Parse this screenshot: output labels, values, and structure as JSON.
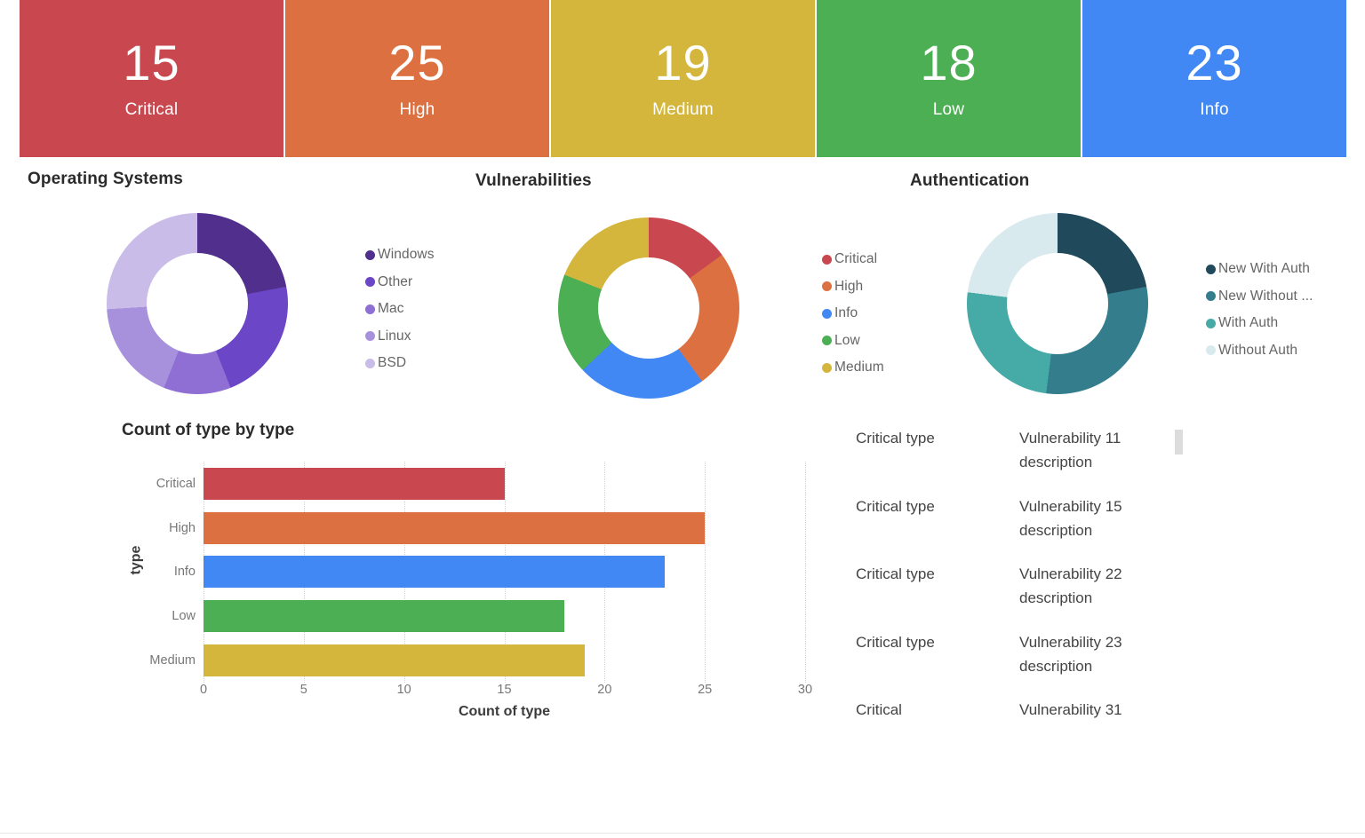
{
  "kpis": [
    {
      "value": "15",
      "label": "Critical",
      "color": "#c9474f"
    },
    {
      "value": "25",
      "label": "High",
      "color": "#dd7040"
    },
    {
      "value": "19",
      "label": "Medium",
      "color": "#d4b63c"
    },
    {
      "value": "18",
      "label": "Low",
      "color": "#4caf54"
    },
    {
      "value": "23",
      "label": "Info",
      "color": "#4288f5"
    }
  ],
  "panels": {
    "operating_systems": {
      "title": "Operating Systems"
    },
    "vulnerabilities": {
      "title": "Vulnerabilities"
    },
    "authentication": {
      "title": "Authentication"
    }
  },
  "bar_panel": {
    "title": "Count of type by type",
    "ylabel": "type",
    "xlabel": "Count of type"
  },
  "vuln_list": {
    "rows": [
      {
        "type": "Critical type",
        "description": "Vulnerability 11 description"
      },
      {
        "type": "Critical type",
        "description": "Vulnerability 15 description"
      },
      {
        "type": "Critical type",
        "description": "Vulnerability 22 description"
      },
      {
        "type": "Critical type",
        "description": "Vulnerability 23 description"
      },
      {
        "type": "Critical",
        "description": "Vulnerability 31"
      }
    ]
  },
  "chart_data": [
    {
      "type": "pie",
      "title": "Operating Systems",
      "variant": "donut",
      "legend_position": "right",
      "labels": [
        "Windows",
        "Other",
        "Mac",
        "Linux",
        "BSD"
      ],
      "values": [
        22,
        22,
        12,
        18,
        26
      ],
      "unit": "percent",
      "colors": [
        "#50308c",
        "#6b46c6",
        "#8f6fd4",
        "#a791dd",
        "#c9bce9"
      ]
    },
    {
      "type": "pie",
      "title": "Vulnerabilities",
      "variant": "donut",
      "legend_position": "right",
      "labels": [
        "Critical",
        "High",
        "Info",
        "Low",
        "Medium"
      ],
      "values": [
        15,
        25,
        23,
        18,
        19
      ],
      "unit": "count",
      "colors": [
        "#c9474f",
        "#dd7040",
        "#4288f5",
        "#4caf54",
        "#d4b63c"
      ],
      "legend_order": [
        "Critical",
        "High",
        "Info",
        "Low",
        "Medium"
      ]
    },
    {
      "type": "pie",
      "title": "Authentication",
      "variant": "donut",
      "legend_position": "right",
      "labels": [
        "New With Auth",
        "New Without ...",
        "With Auth",
        "Without Auth"
      ],
      "values": [
        22,
        30,
        25,
        23
      ],
      "unit": "percent",
      "colors": [
        "#204a5c",
        "#337d8c",
        "#46aaa6",
        "#d9eaef"
      ]
    },
    {
      "type": "bar",
      "orientation": "horizontal",
      "title": "Count of type by type",
      "categories": [
        "Critical",
        "High",
        "Info",
        "Low",
        "Medium"
      ],
      "values": [
        15,
        25,
        23,
        18,
        19
      ],
      "colors": [
        "#c9474f",
        "#dd7040",
        "#4288f5",
        "#4caf54",
        "#d4b63c"
      ],
      "xlabel": "Count of type",
      "ylabel": "type",
      "xlim": [
        0,
        30
      ],
      "xticks": [
        0,
        5,
        10,
        15,
        20,
        25,
        30
      ],
      "grid": true
    }
  ]
}
